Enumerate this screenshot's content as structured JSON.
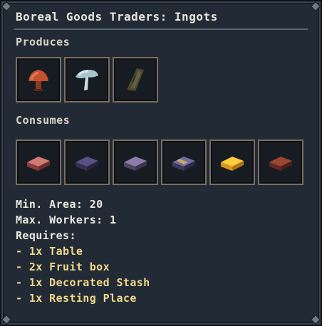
{
  "tooltip": {
    "title": "Boreal Goods Traders: Ingots",
    "produces_label": "Produces",
    "consumes_label": "Consumes",
    "produces_icons": [
      "red-mushroom-icon",
      "pale-mushroom-icon",
      "wooden-plank-icon"
    ],
    "consumes_icons": [
      "red-ingot-icon",
      "dark-purple-ingot-icon",
      "gray-purple-ingot-icon",
      "blue-gold-ingot-icon",
      "gold-ingot-icon",
      "copper-ingot-icon"
    ],
    "min_area": "Min. Area: 20",
    "max_workers": "Max. Workers: 1",
    "requires_label": "Requires:",
    "requirements": [
      "- 1x Table",
      "- 2x Fruit box",
      "- 1x Decorated Stash",
      "- 1x Resting Place"
    ]
  },
  "colors": {
    "background": "#222b35",
    "title_text": "#e8e6dc",
    "requirement_text": "#f0d98a",
    "slot_border": "#7b6d5f"
  }
}
